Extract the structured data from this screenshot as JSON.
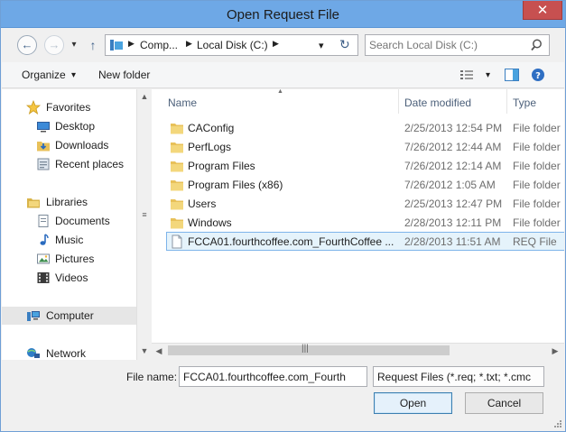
{
  "window": {
    "title": "Open Request File",
    "close_glyph": "✕"
  },
  "nav": {
    "back": "←",
    "forward": "→",
    "recent": "▾",
    "up": "↑"
  },
  "address": {
    "crumbs": [
      "Comp...",
      "Local Disk (C:)"
    ],
    "sep": "▶",
    "dropdown": "▾",
    "refresh": "↻"
  },
  "search": {
    "placeholder": "Search Local Disk (C:)"
  },
  "toolbar": {
    "organize_label": "Organize",
    "organize_arrow": "▾",
    "new_folder_label": "New folder",
    "view_arrow": "▾"
  },
  "sidebar": {
    "favorites": {
      "label": "Favorites",
      "items": [
        "Desktop",
        "Downloads",
        "Recent places"
      ]
    },
    "libraries": {
      "label": "Libraries",
      "items": [
        "Documents",
        "Music",
        "Pictures",
        "Videos"
      ]
    },
    "computer": "Computer",
    "network": "Network",
    "scroll_up": "▲",
    "scroll_down": "▼",
    "scroll_grip": "≡"
  },
  "columns": {
    "name": "Name",
    "date": "Date modified",
    "type": "Type",
    "sort_glyph": "▲"
  },
  "files": [
    {
      "name": "CAConfig",
      "date": "2/25/2013 12:54 PM",
      "type": "File folder",
      "kind": "folder"
    },
    {
      "name": "PerfLogs",
      "date": "7/26/2012 12:44 AM",
      "type": "File folder",
      "kind": "folder"
    },
    {
      "name": "Program Files",
      "date": "7/26/2012 12:14 AM",
      "type": "File folder",
      "kind": "folder"
    },
    {
      "name": "Program Files (x86)",
      "date": "7/26/2012 1:05 AM",
      "type": "File folder",
      "kind": "folder"
    },
    {
      "name": "Users",
      "date": "2/25/2013 12:47 PM",
      "type": "File folder",
      "kind": "folder"
    },
    {
      "name": "Windows",
      "date": "2/28/2013 12:11 PM",
      "type": "File folder",
      "kind": "folder"
    },
    {
      "name": "FCCA01.fourthcoffee.com_FourthCoffee ...",
      "date": "2/28/2013 11:51 AM",
      "type": "REQ File",
      "kind": "file",
      "selected": true
    }
  ],
  "hscroll": {
    "left": "◀",
    "right": "▶",
    "grip": "|||"
  },
  "bottom": {
    "file_name_label": "File name:",
    "file_name_value": "FCCA01.fourthcoffee.com_Fourth",
    "filter_value": "Request Files (*.req; *.txt; *.cmc",
    "filter_arrow": "▾",
    "open_label": "Open",
    "cancel_label": "Cancel"
  },
  "colors": {
    "titlebar": "#6ea8e6",
    "close": "#c75050",
    "selection": "#e5f3fb",
    "selection_border": "#7eb4ea",
    "folder": "#e8c15a"
  }
}
